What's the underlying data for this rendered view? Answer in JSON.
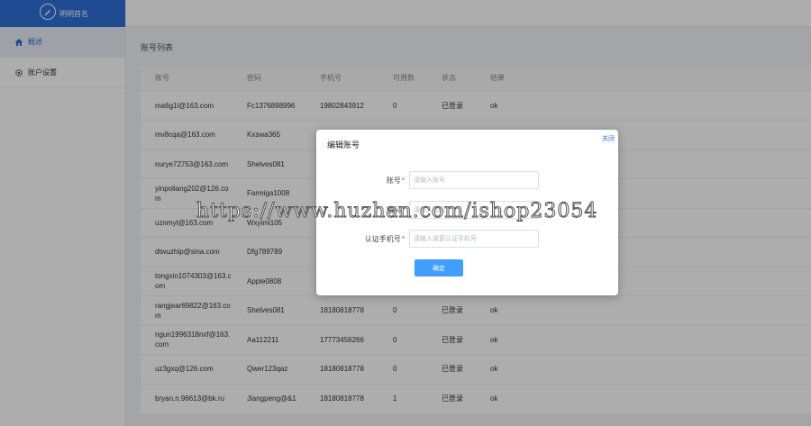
{
  "sidebar": {
    "brand_label": "明明首名",
    "items": [
      {
        "label": "概述",
        "icon": "home-icon"
      },
      {
        "label": "账户设置",
        "icon": "gear-icon"
      }
    ]
  },
  "main": {
    "section_title": "账号列表",
    "columns": [
      "账号",
      "密码",
      "手机号",
      "可用数",
      "状态",
      "结果"
    ],
    "rows": [
      [
        "ma6g1l@163.com",
        "Fc1376898996",
        "19802843912",
        "0",
        "已登录",
        "ok"
      ],
      [
        "mv8cqa@163.com",
        "Kxswa365",
        "",
        "",
        "",
        ""
      ],
      [
        "nurye72753@163.com",
        "Shelves081",
        "",
        "",
        "",
        ""
      ],
      [
        "yinpoliang202@126.com",
        "Farmiga1008",
        "",
        "",
        "",
        ""
      ],
      [
        "uznmyl@163.com",
        "Wxyimi105",
        "",
        "",
        "",
        ""
      ],
      [
        "dtwuzhip@sina.com",
        "Dfg789789",
        "",
        "",
        "",
        ""
      ],
      [
        "tongxin1074303@163.com",
        "Apple0808",
        "",
        "",
        "",
        ""
      ],
      [
        "rangjear69822@163.com",
        "Shelves081",
        "18180818778",
        "0",
        "已登录",
        "ok"
      ],
      [
        "ngun1996318nxf@163.com",
        "Aa112211",
        "17773456266",
        "0",
        "已登录",
        "ok"
      ],
      [
        "uz3gxq@126.com",
        "Qwer123qaz",
        "18180818778",
        "0",
        "已登录",
        "ok"
      ],
      [
        "bryan.n.96613@bk.ru",
        "Jiangpeng@&1",
        "18180818778",
        "1",
        "已登录",
        "ok"
      ]
    ]
  },
  "modal": {
    "title": "编辑账号",
    "close_label": "关闭",
    "fields": [
      {
        "label": "账号",
        "placeholder": "请输入账号"
      },
      {
        "label": "密码",
        "placeholder": "请输入密码"
      },
      {
        "label": "认证手机号",
        "placeholder": "请输入或更认证手机号"
      }
    ],
    "submit_label": "确定"
  },
  "watermark": "https://www.huzhan.com/ishop23054",
  "colors": {
    "brand": "#2d6fd8",
    "primary_button": "#409eff",
    "required_mark": "#e33333"
  }
}
